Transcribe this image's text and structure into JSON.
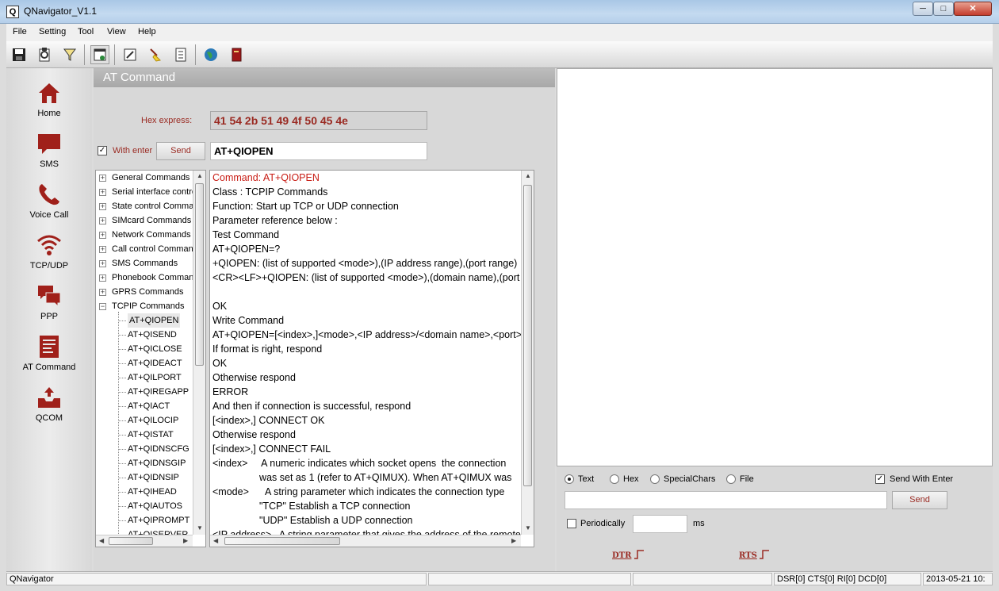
{
  "window": {
    "title": "QNavigator_V1.1",
    "icon_letter": "Q",
    "minimize": "─",
    "maximize": "□",
    "close": "✕"
  },
  "menu": [
    "File",
    "Setting",
    "Tool",
    "View",
    "Help"
  ],
  "toolbar": [
    "save-icon",
    "settings-clip-icon",
    "funnel-icon",
    "new-window-icon",
    "edit-doc-icon",
    "broom-icon",
    "list-icon",
    "globe-icon",
    "book-icon"
  ],
  "nav": [
    {
      "label": "Home",
      "icon": "home-icon"
    },
    {
      "label": "SMS",
      "icon": "sms-icon"
    },
    {
      "label": "Voice Call",
      "icon": "phone-icon"
    },
    {
      "label": "TCP/UDP",
      "icon": "wifi-icon"
    },
    {
      "label": "PPP",
      "icon": "chat-icon"
    },
    {
      "label": "AT Command",
      "icon": "at-command-icon"
    },
    {
      "label": "QCOM",
      "icon": "inbox-icon"
    }
  ],
  "panel": {
    "header": "AT Command",
    "hex_label": "Hex express:",
    "hex_value": "41 54 2b 51 49 4f 50 45 4e",
    "with_enter_label": "With enter",
    "with_enter_checked": "✓",
    "send_label": "Send",
    "command_value": "AT+QIOPEN"
  },
  "tree": {
    "groups": [
      {
        "label": "General Commands",
        "sign": "+"
      },
      {
        "label": "Serial interface control",
        "sign": "+"
      },
      {
        "label": "State control Commands",
        "sign": "+"
      },
      {
        "label": "SIMcard Commands",
        "sign": "+"
      },
      {
        "label": "Network Commands",
        "sign": "+"
      },
      {
        "label": "Call control Commands",
        "sign": "+"
      },
      {
        "label": "SMS Commands",
        "sign": "+"
      },
      {
        "label": "Phonebook Commands",
        "sign": "+"
      },
      {
        "label": "GPRS Commands",
        "sign": "+"
      },
      {
        "label": "TCPIP Commands",
        "sign": "−"
      }
    ],
    "children": [
      "AT+QIOPEN",
      "AT+QISEND",
      "AT+QICLOSE",
      "AT+QIDEACT",
      "AT+QILPORT",
      "AT+QIREGAPP",
      "AT+QIACT",
      "AT+QILOCIP",
      "AT+QISTAT",
      "AT+QIDNSCFG",
      "AT+QIDNSGIP",
      "AT+QIDNSIP",
      "AT+QIHEAD",
      "AT+QIAUTOS",
      "AT+QIPROMPT",
      "AT+QISERVER"
    ]
  },
  "detail": {
    "lines": [
      "Command:      AT+QIOPEN",
      "Class     : TCPIP Commands",
      "Function: Start up TCP or UDP connection",
      "Parameter reference below :",
      "Test Command",
      "AT+QIOPEN=?",
      "+QIOPEN: (list of supported <mode>),(IP address range),(port range)",
      "<CR><LF>+QIOPEN: (list of supported <mode>),(domain name),(port range)",
      "",
      "OK",
      "Write Command",
      "AT+QIOPEN=[<index>,]<mode>,<IP address>/<domain name>,<port>",
      "If format is right, respond",
      "OK",
      "Otherwise respond",
      "ERROR",
      "And then if connection is successful, respond",
      "[<index>,] CONNECT OK",
      "Otherwise respond",
      "[<index>,] CONNECT FAIL",
      "<index>     A numeric indicates which socket opens  the connection",
      "                 was set as 1 (refer to AT+QIMUX). When AT+QIMUX was",
      "<mode>      A string parameter which indicates the connection type",
      "                 \"TCP\" Establish a TCP connection",
      "                 \"UDP\" Establish a UDP connection",
      "<IP address>   A string parameter that gives the address of the remote"
    ]
  },
  "send_area": {
    "modes": [
      {
        "label": "Text",
        "selected": true
      },
      {
        "label": "Hex",
        "selected": false
      },
      {
        "label": "SpecialChars",
        "selected": false
      },
      {
        "label": "File",
        "selected": false
      }
    ],
    "send_with_enter_label": "Send With Enter",
    "send_with_enter_checked": "✓",
    "send_label": "Send",
    "send_value": "",
    "periodically_label": "Periodically",
    "periodically_checked": "",
    "period_value": "",
    "ms_label": "ms",
    "dtr_label": "DTR",
    "rts_label": "RTS"
  },
  "status": {
    "app": "QNavigator",
    "signals": "DSR[0] CTS[0] RI[0] DCD[0]",
    "datetime": "2013-05-21 10:"
  },
  "colors": {
    "accent": "#9a2a22",
    "highlight": "#c81c14",
    "icon": "#a0201a"
  }
}
